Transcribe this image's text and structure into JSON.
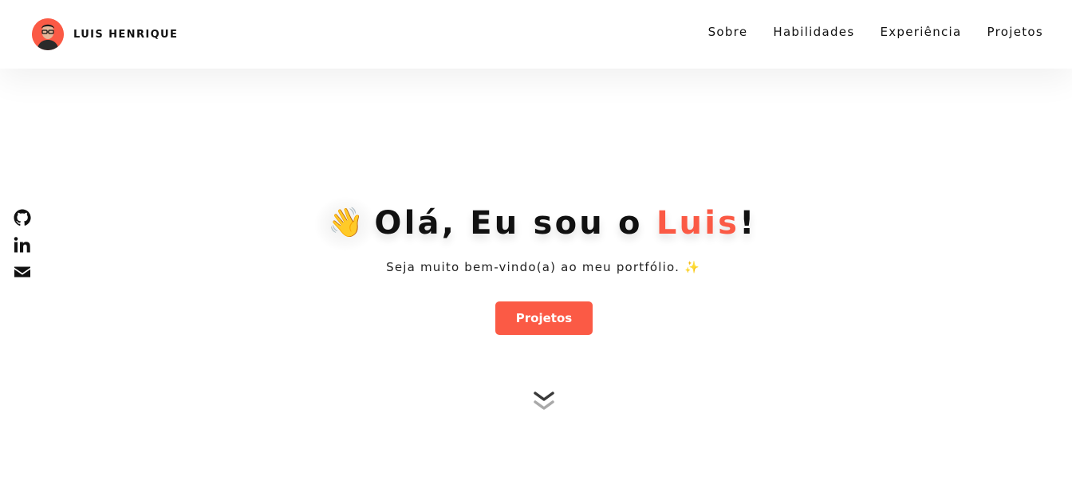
{
  "header": {
    "brand_name": "LUIS HENRIQUE",
    "nav_items": [
      {
        "label": "Sobre"
      },
      {
        "label": "Habilidades"
      },
      {
        "label": "Experiência"
      },
      {
        "label": "Projetos"
      }
    ]
  },
  "social": [
    {
      "icon": "github-icon"
    },
    {
      "icon": "linkedin-icon"
    },
    {
      "icon": "mail-icon"
    }
  ],
  "hero": {
    "emoji": "👋",
    "greeting_prefix": "Olá, Eu sou o ",
    "name": "Luis",
    "greeting_suffix": "!",
    "subtitle": "Seja muito bem-vindo(a) ao meu portfólio.",
    "subtitle_emoji": "✨",
    "cta_label": "Projetos"
  },
  "colors": {
    "accent": "#fb5a45",
    "text": "#111111",
    "background": "#ffffff"
  }
}
